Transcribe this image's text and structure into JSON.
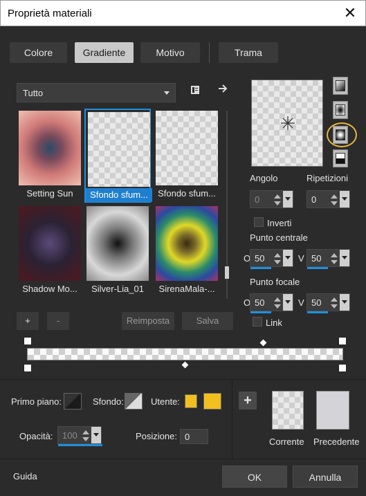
{
  "window": {
    "title": "Proprietà materiali",
    "close_glyph": "✕"
  },
  "tabs": [
    {
      "label": "Colore",
      "active": false
    },
    {
      "label": "Gradiente",
      "active": true
    },
    {
      "label": "Motivo",
      "active": false
    },
    {
      "label": "Trama",
      "active": false
    }
  ],
  "category_dropdown": {
    "value": "Tutto"
  },
  "gallery": {
    "items": [
      {
        "label": "Setting Sun",
        "selected": false
      },
      {
        "label": "Sfondo sfum...",
        "selected": true
      },
      {
        "label": "Sfondo sfum...",
        "selected": false
      },
      {
        "label": "Shadow Mo...",
        "selected": false
      },
      {
        "label": "Silver-Lia_01",
        "selected": false
      },
      {
        "label": "SirenaMala-...",
        "selected": false
      }
    ]
  },
  "gallery_buttons": {
    "add": "+",
    "remove": "-",
    "reset": "Reimposta",
    "save": "Salva"
  },
  "angle": {
    "label": "Angolo",
    "value": "0"
  },
  "repeats": {
    "label": "Ripetizioni",
    "value": "0"
  },
  "invert": {
    "label": "Inverti",
    "checked": false
  },
  "center_point": {
    "label": "Punto centrale",
    "o_label": "O",
    "v_label": "V",
    "o_value": "50",
    "v_value": "50"
  },
  "focal_point": {
    "label": "Punto focale",
    "o_label": "O",
    "v_label": "V",
    "o_value": "50",
    "v_value": "50"
  },
  "link": {
    "label": "Link",
    "checked": false
  },
  "materials": {
    "foreground_label": "Primo piano:",
    "background_label": "Sfondo:",
    "user_label": "Utente:",
    "user_color": "#f2c01e",
    "opacity_label": "Opacità:",
    "opacity_value": "100",
    "position_label": "Posizione:",
    "position_value": "0"
  },
  "preview": {
    "current_label": "Corrente",
    "previous_label": "Precedente"
  },
  "footer": {
    "help": "Guida",
    "ok": "OK",
    "cancel": "Annulla"
  }
}
